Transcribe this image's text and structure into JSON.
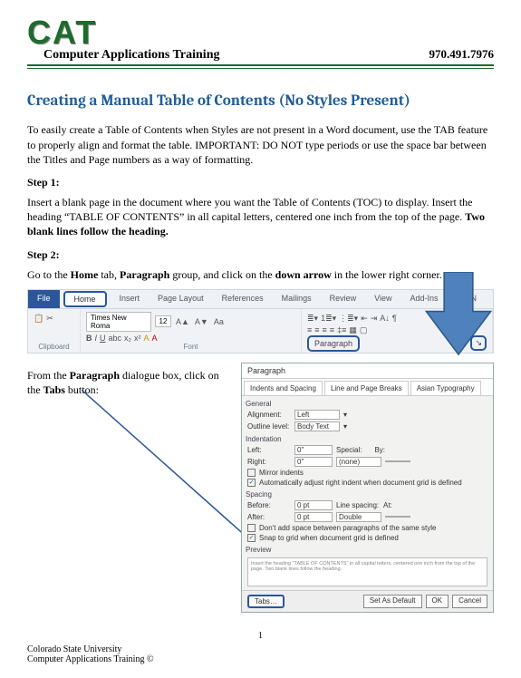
{
  "header": {
    "logo_text": "CAT",
    "tagline": "Computer Applications Training",
    "phone": "970.491.7976"
  },
  "title": "Creating a Manual Table of Contents (No Styles Present)",
  "intro": "To easily create a Table of Contents when Styles are not present in a Word document, use the TAB feature to properly align and format the table.  IMPORTANT:  DO NOT type periods or use the space bar between the Titles and Page numbers as a way of formatting.",
  "steps": {
    "step1_label": "Step 1:",
    "step1_text_a": "Insert a blank page in the document where you want the Table of Contents (TOC) to display. Insert the heading “TABLE OF CONTENTS” in all capital letters, centered one inch from the top of the page.  ",
    "step1_text_b": "Two blank lines follow the heading.",
    "step2_label": "Step 2:",
    "step2_a": "Go to the ",
    "step2_b": "Home",
    "step2_c": " tab, ",
    "step2_d": "Paragraph",
    "step2_e": " group, and click on the ",
    "step2_f": "down arrow",
    "step2_g": " in the lower right corner."
  },
  "ribbon": {
    "tabs": [
      "File",
      "Home",
      "Insert",
      "Page Layout",
      "References",
      "Mailings",
      "Review",
      "View",
      "Add-Ins",
      "EndN"
    ],
    "font_name": "Times New Roma",
    "font_size": "12",
    "group_clipboard": "Clipboard",
    "group_font": "Font",
    "group_paragraph": "Paragraph"
  },
  "note2_a": "From the ",
  "note2_b": "Paragraph",
  "note2_c": " dialogue box, click on the ",
  "note2_d": "Tabs",
  "note2_e": " button:",
  "dialog": {
    "title": "Paragraph",
    "tabs": [
      "Indents and Spacing",
      "Line and Page Breaks",
      "Asian Typography"
    ],
    "general": "General",
    "alignment_label": "Alignment:",
    "alignment_value": "Left",
    "outline_label": "Outline level:",
    "outline_value": "Body Text",
    "indentation": "Indentation",
    "left_label": "Left:",
    "left_value": "0\"",
    "right_label": "Right:",
    "right_value": "0\"",
    "special_label": "Special:",
    "special_value": "(none)",
    "by_label": "By:",
    "mirror": "Mirror indents",
    "auto_indent": "Automatically adjust right indent when document grid is defined",
    "spacing": "Spacing",
    "before_label": "Before:",
    "before_value": "0 pt",
    "after_label": "After:",
    "after_value": "0 pt",
    "line_label": "Line spacing:",
    "line_value": "Double",
    "at_label": "At:",
    "no_space": "Don't add space between paragraphs of the same style",
    "snap": "Snap to grid when document grid is defined",
    "preview": "Preview",
    "tabs_btn": "Tabs…",
    "default_btn": "Set As Default",
    "ok_btn": "OK",
    "cancel_btn": "Cancel"
  },
  "footer": {
    "page": "1",
    "line1": "Colorado State University",
    "line2": "Computer Applications Training ©"
  }
}
